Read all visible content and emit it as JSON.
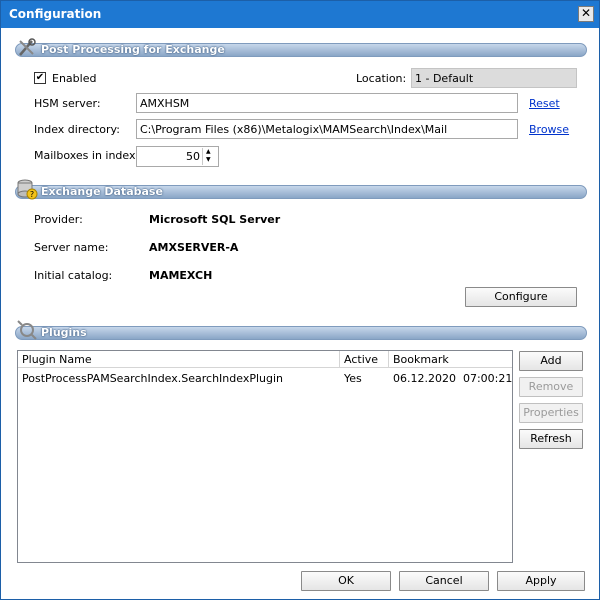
{
  "window": {
    "title": "Configuration",
    "close_glyph": "✕"
  },
  "post_processing": {
    "title": "Post Processing for Exchange",
    "icon": "tools-icon",
    "enabled": {
      "label": "Enabled",
      "checked": true,
      "mark": "✔"
    },
    "location": {
      "label": "Location:",
      "value": "1 - Default"
    },
    "hsm_server": {
      "label": "HSM server:",
      "value": "AMXHSM",
      "link": "Reset"
    },
    "index_directory": {
      "label": "Index directory:",
      "value": "C:\\Program Files (x86)\\Metalogix\\MAMSearch\\Index\\Mail",
      "link": "Browse"
    },
    "mailboxes_in_index": {
      "label": "Mailboxes in index:",
      "value": "50"
    }
  },
  "exchange_database": {
    "title": "Exchange Database",
    "icon": "database-icon",
    "provider": {
      "label": "Provider:",
      "value": "Microsoft SQL Server"
    },
    "server_name": {
      "label": "Server name:",
      "value": "AMXSERVER-A"
    },
    "initial_catalog": {
      "label": "Initial catalog:",
      "value": "MAMEXCH"
    },
    "configure_button": "Configure"
  },
  "plugins": {
    "title": "Plugins",
    "icon": "plug-icon",
    "columns": [
      "Plugin Name",
      "Active",
      "Bookmark"
    ],
    "rows": [
      {
        "name": "PostProcessPAMSearchIndex.SearchIndexPlugin",
        "active": "Yes",
        "bookmark": "06.12.2020  07:00:21"
      }
    ],
    "buttons": {
      "add": "Add",
      "remove": "Remove",
      "properties": "Properties",
      "refresh": "Refresh"
    }
  },
  "footer": {
    "ok": "OK",
    "cancel": "Cancel",
    "apply": "Apply"
  },
  "colors": {
    "title_bar": "#1e78d2",
    "section_bar": "#9fb6d2",
    "link": "#0033cc"
  }
}
